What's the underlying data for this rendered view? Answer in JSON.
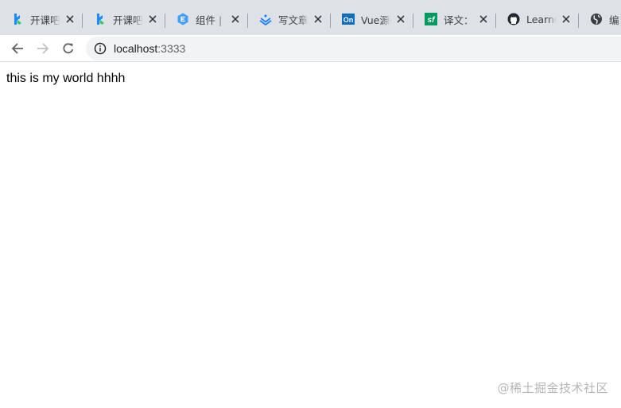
{
  "tabs": [
    {
      "title": "开课吧",
      "icon": "kaikeba-logo-icon"
    },
    {
      "title": "开课吧",
      "icon": "kaikeba-logo-icon"
    },
    {
      "title": "组件 | E",
      "icon": "element-ui-logo-icon"
    },
    {
      "title": "写文章",
      "icon": "juejin-logo-icon"
    },
    {
      "title": "Vue源码",
      "icon": "onenote-logo-icon",
      "icon_text": "On"
    },
    {
      "title": "译文：",
      "icon": "segmentfault-logo-icon",
      "icon_text": "sf"
    },
    {
      "title": "LearnG",
      "icon": "github-logo-icon"
    },
    {
      "title": "编",
      "icon": "globe-icon"
    }
  ],
  "toolbar": {
    "back_icon": "arrow-left-icon",
    "forward_icon": "arrow-right-icon",
    "reload_icon": "reload-icon",
    "info_icon": "info-icon"
  },
  "address_bar": {
    "host": "localhost",
    "port": ":3333"
  },
  "page": {
    "text": "this is my world hhhh"
  },
  "watermark": "@稀土掘金技术社区",
  "colors": {
    "tabstrip_bg": "#dee1e6",
    "omnibox_bg": "#f1f3f4",
    "kaikeba_blue": "#1a8cff",
    "element_blue": "#409eff",
    "juejin_blue": "#1e80ff",
    "onenote_blue": "#0f6cbd",
    "segmentfault_green": "#009a61"
  }
}
